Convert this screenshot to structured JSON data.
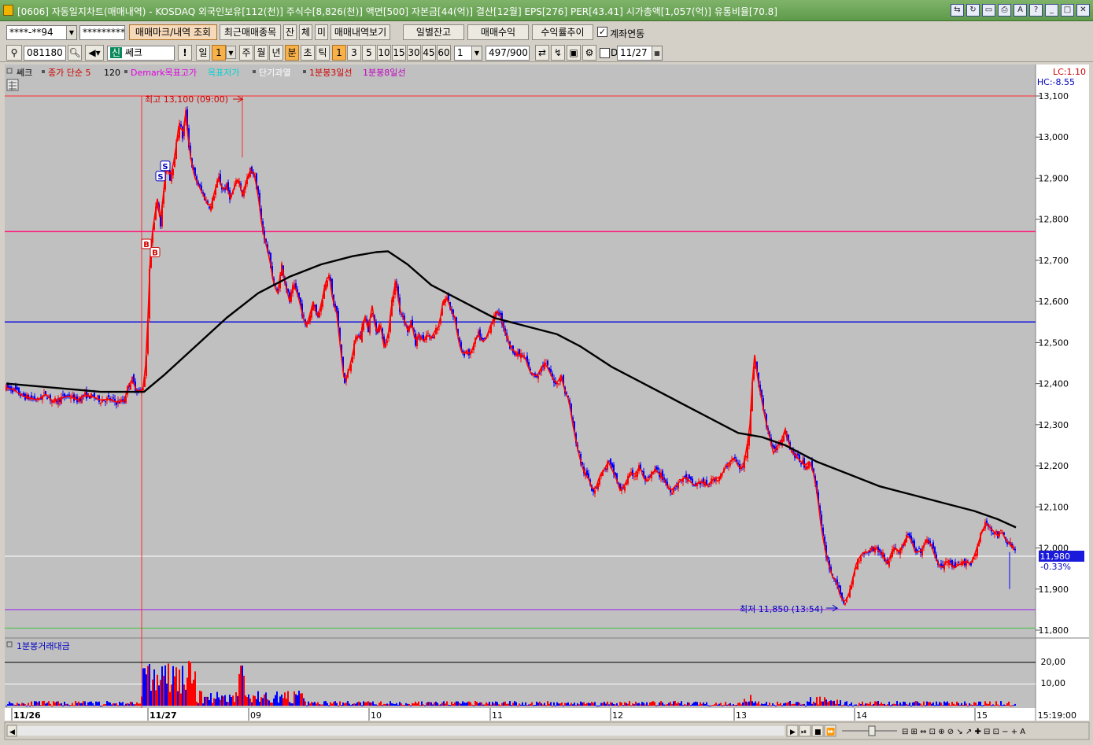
{
  "window": {
    "title": "[0606] 자동일지차트(매매내역) - KOSDAQ 외국인보유[112(천)] 주식수[8,826(천)] 액면[500] 자본금[44(억)] 결산[12월] EPS[276] PER[43.41] 시가총액[1,057(억)] 유통비율[70.8]"
  },
  "toolbar1": {
    "account": "****-**94",
    "password": "*********",
    "btn_markers": "매매마크/내역 조회",
    "btn_recent": "최근매매종목",
    "btn_jan": "잔",
    "btn_che": "체",
    "btn_mi": "미",
    "btn_history": "매매내역보기",
    "btn_daily_balance": "일별잔고",
    "btn_trade_profit": "매매수익",
    "btn_return_trend": "수익률추이",
    "link_label": "계좌연동",
    "link_checked": true
  },
  "toolbar2": {
    "code": "081180",
    "name": "쎄크",
    "name_prefix": "신",
    "exclaim": "!",
    "periods": [
      "일",
      "1",
      "주",
      "월",
      "년",
      "분",
      "초",
      "틱"
    ],
    "intervals": [
      "1",
      "3",
      "5",
      "10",
      "15",
      "30",
      "45",
      "60"
    ],
    "interval_value": "1",
    "count": "497/900",
    "d_label": "D",
    "date": "11/27"
  },
  "chart_data": {
    "type": "candlestick",
    "legend": [
      "쎄크",
      "종가 단순 5",
      "120",
      "Demark목표고가",
      "목표저가",
      "단기과열",
      "1분봉3일선",
      "1분봉8일선"
    ],
    "lc_label": "LC:1.10",
    "hc_label": "HC:-8.55",
    "ylim": [
      11800,
      13100
    ],
    "yticks": [
      "13,100",
      "13,000",
      "12,900",
      "12,800",
      "12,700",
      "12,600",
      "12,500",
      "12,400",
      "12,300",
      "12,200",
      "12,100",
      "12,000",
      "11,900",
      "11,800"
    ],
    "current_price": "11,980",
    "current_change": "-0.33%",
    "high_annotation": "최고 13,100 (09:00)",
    "low_annotation": "최저 11,850 (13:54)",
    "hlines": [
      {
        "value": 13100,
        "color": "#ff2a2a"
      },
      {
        "value": 12770,
        "color": "#ff1a7a"
      },
      {
        "value": 12550,
        "color": "#1010dd"
      },
      {
        "value": 11980,
        "color": "#ffffff"
      },
      {
        "value": 11850,
        "color": "#a020f0"
      },
      {
        "value": 11805,
        "color": "#40c040"
      }
    ],
    "x_labels": [
      "11/26",
      "11/27",
      "09",
      "10",
      "11",
      "12",
      "13",
      "14",
      "15"
    ],
    "time_label": "15:19:00",
    "price_path": [
      [
        0,
        12390
      ],
      [
        10,
        12385
      ],
      [
        20,
        12370
      ],
      [
        30,
        12365
      ],
      [
        40,
        12360
      ],
      [
        50,
        12375
      ],
      [
        60,
        12355
      ],
      [
        70,
        12365
      ],
      [
        80,
        12370
      ],
      [
        90,
        12360
      ],
      [
        100,
        12372
      ],
      [
        110,
        12368
      ],
      [
        120,
        12360
      ],
      [
        130,
        12362
      ],
      [
        140,
        12355
      ],
      [
        150,
        12358
      ],
      [
        155,
        12395
      ],
      [
        160,
        12410
      ],
      [
        165,
        12385
      ],
      [
        170,
        12380
      ],
      [
        175,
        12395
      ],
      [
        178,
        12470
      ],
      [
        180,
        12560
      ],
      [
        182,
        12680
      ],
      [
        185,
        12760
      ],
      [
        188,
        12800
      ],
      [
        192,
        12850
      ],
      [
        196,
        12790
      ],
      [
        200,
        12870
      ],
      [
        204,
        12940
      ],
      [
        208,
        12900
      ],
      [
        212,
        12930
      ],
      [
        216,
        12980
      ],
      [
        220,
        13040
      ],
      [
        224,
        13000
      ],
      [
        228,
        13060
      ],
      [
        232,
        12980
      ],
      [
        236,
        12930
      ],
      [
        240,
        12900
      ],
      [
        245,
        12880
      ],
      [
        250,
        12860
      ],
      [
        255,
        12840
      ],
      [
        260,
        12830
      ],
      [
        265,
        12870
      ],
      [
        270,
        12900
      ],
      [
        275,
        12870
      ],
      [
        280,
        12880
      ],
      [
        285,
        12850
      ],
      [
        290,
        12880
      ],
      [
        295,
        12900
      ],
      [
        300,
        12860
      ],
      [
        305,
        12890
      ],
      [
        310,
        12920
      ],
      [
        315,
        12910
      ],
      [
        320,
        12860
      ],
      [
        325,
        12780
      ],
      [
        330,
        12740
      ],
      [
        335,
        12700
      ],
      [
        340,
        12640
      ],
      [
        345,
        12620
      ],
      [
        350,
        12690
      ],
      [
        355,
        12640
      ],
      [
        360,
        12600
      ],
      [
        365,
        12640
      ],
      [
        370,
        12620
      ],
      [
        375,
        12580
      ],
      [
        380,
        12540
      ],
      [
        385,
        12560
      ],
      [
        390,
        12600
      ],
      [
        395,
        12560
      ],
      [
        400,
        12590
      ],
      [
        405,
        12640
      ],
      [
        410,
        12670
      ],
      [
        415,
        12600
      ],
      [
        420,
        12570
      ],
      [
        425,
        12480
      ],
      [
        430,
        12400
      ],
      [
        435,
        12430
      ],
      [
        440,
        12470
      ],
      [
        445,
        12520
      ],
      [
        450,
        12510
      ],
      [
        455,
        12570
      ],
      [
        460,
        12530
      ],
      [
        465,
        12590
      ],
      [
        470,
        12520
      ],
      [
        475,
        12550
      ],
      [
        480,
        12490
      ],
      [
        485,
        12510
      ],
      [
        490,
        12600
      ],
      [
        495,
        12650
      ],
      [
        500,
        12580
      ],
      [
        505,
        12560
      ],
      [
        510,
        12530
      ],
      [
        515,
        12550
      ],
      [
        520,
        12500
      ],
      [
        525,
        12520
      ],
      [
        530,
        12500
      ],
      [
        535,
        12520
      ],
      [
        540,
        12510
      ],
      [
        545,
        12530
      ],
      [
        550,
        12540
      ],
      [
        555,
        12600
      ],
      [
        560,
        12610
      ],
      [
        565,
        12580
      ],
      [
        570,
        12560
      ],
      [
        575,
        12500
      ],
      [
        580,
        12470
      ],
      [
        585,
        12480
      ],
      [
        590,
        12470
      ],
      [
        595,
        12500
      ],
      [
        600,
        12520
      ],
      [
        605,
        12500
      ],
      [
        610,
        12510
      ],
      [
        615,
        12540
      ],
      [
        620,
        12560
      ],
      [
        625,
        12580
      ],
      [
        630,
        12550
      ],
      [
        635,
        12520
      ],
      [
        640,
        12490
      ],
      [
        645,
        12480
      ],
      [
        650,
        12470
      ],
      [
        655,
        12470
      ],
      [
        660,
        12460
      ],
      [
        665,
        12430
      ],
      [
        670,
        12420
      ],
      [
        675,
        12420
      ],
      [
        680,
        12440
      ],
      [
        685,
        12450
      ],
      [
        690,
        12430
      ],
      [
        695,
        12410
      ],
      [
        700,
        12400
      ],
      [
        705,
        12420
      ],
      [
        710,
        12380
      ],
      [
        715,
        12360
      ],
      [
        720,
        12300
      ],
      [
        725,
        12250
      ],
      [
        730,
        12210
      ],
      [
        735,
        12180
      ],
      [
        740,
        12170
      ],
      [
        745,
        12140
      ],
      [
        750,
        12150
      ],
      [
        755,
        12180
      ],
      [
        760,
        12190
      ],
      [
        765,
        12210
      ],
      [
        770,
        12190
      ],
      [
        775,
        12170
      ],
      [
        780,
        12140
      ],
      [
        785,
        12150
      ],
      [
        790,
        12170
      ],
      [
        795,
        12180
      ],
      [
        800,
        12180
      ],
      [
        805,
        12200
      ],
      [
        810,
        12170
      ],
      [
        815,
        12160
      ],
      [
        820,
        12180
      ],
      [
        825,
        12190
      ],
      [
        830,
        12180
      ],
      [
        835,
        12170
      ],
      [
        840,
        12150
      ],
      [
        845,
        12140
      ],
      [
        850,
        12150
      ],
      [
        855,
        12160
      ],
      [
        860,
        12170
      ],
      [
        865,
        12170
      ],
      [
        870,
        12160
      ],
      [
        875,
        12150
      ],
      [
        880,
        12160
      ],
      [
        885,
        12160
      ],
      [
        890,
        12150
      ],
      [
        895,
        12160
      ],
      [
        900,
        12170
      ],
      [
        905,
        12170
      ],
      [
        910,
        12180
      ],
      [
        915,
        12200
      ],
      [
        920,
        12210
      ],
      [
        925,
        12220
      ],
      [
        930,
        12200
      ],
      [
        935,
        12190
      ],
      [
        940,
        12230
      ],
      [
        945,
        12300
      ],
      [
        948,
        12400
      ],
      [
        951,
        12470
      ],
      [
        955,
        12410
      ],
      [
        960,
        12360
      ],
      [
        965,
        12310
      ],
      [
        970,
        12270
      ],
      [
        975,
        12230
      ],
      [
        980,
        12250
      ],
      [
        985,
        12260
      ],
      [
        990,
        12290
      ],
      [
        995,
        12250
      ],
      [
        1000,
        12230
      ],
      [
        1005,
        12220
      ],
      [
        1010,
        12210
      ],
      [
        1015,
        12200
      ],
      [
        1020,
        12210
      ],
      [
        1025,
        12190
      ],
      [
        1030,
        12140
      ],
      [
        1035,
        12060
      ],
      [
        1040,
        12000
      ],
      [
        1045,
        11960
      ],
      [
        1050,
        11930
      ],
      [
        1055,
        11920
      ],
      [
        1060,
        11880
      ],
      [
        1065,
        11870
      ],
      [
        1070,
        11880
      ],
      [
        1075,
        11920
      ],
      [
        1080,
        11960
      ],
      [
        1085,
        11980
      ],
      [
        1090,
        11990
      ],
      [
        1095,
        11990
      ],
      [
        1100,
        12000
      ],
      [
        1105,
        12000
      ],
      [
        1110,
        11990
      ],
      [
        1115,
        11980
      ],
      [
        1120,
        11960
      ],
      [
        1125,
        11990
      ],
      [
        1130,
        12000
      ],
      [
        1135,
        11990
      ],
      [
        1140,
        12010
      ],
      [
        1145,
        12030
      ],
      [
        1150,
        12020
      ],
      [
        1155,
        11990
      ],
      [
        1160,
        11990
      ],
      [
        1165,
        12000
      ],
      [
        1170,
        12020
      ],
      [
        1175,
        12010
      ],
      [
        1180,
        11980
      ],
      [
        1185,
        11960
      ],
      [
        1190,
        11950
      ],
      [
        1195,
        11970
      ],
      [
        1200,
        11960
      ],
      [
        1205,
        11950
      ],
      [
        1210,
        11960
      ],
      [
        1215,
        11960
      ],
      [
        1220,
        11970
      ],
      [
        1225,
        11960
      ],
      [
        1230,
        11980
      ],
      [
        1235,
        12010
      ],
      [
        1240,
        12040
      ],
      [
        1245,
        12060
      ],
      [
        1250,
        12050
      ],
      [
        1255,
        12040
      ],
      [
        1260,
        12030
      ],
      [
        1265,
        12040
      ],
      [
        1270,
        12020
      ],
      [
        1275,
        12010
      ],
      [
        1280,
        12000
      ],
      [
        1283,
        11990
      ]
    ],
    "ma120_path": [
      [
        0,
        12400
      ],
      [
        60,
        12390
      ],
      [
        120,
        12380
      ],
      [
        175,
        12380
      ],
      [
        200,
        12420
      ],
      [
        240,
        12490
      ],
      [
        280,
        12560
      ],
      [
        320,
        12620
      ],
      [
        360,
        12660
      ],
      [
        400,
        12690
      ],
      [
        440,
        12710
      ],
      [
        470,
        12720
      ],
      [
        485,
        12722
      ],
      [
        510,
        12690
      ],
      [
        540,
        12640
      ],
      [
        580,
        12600
      ],
      [
        620,
        12560
      ],
      [
        660,
        12540
      ],
      [
        700,
        12520
      ],
      [
        730,
        12490
      ],
      [
        770,
        12440
      ],
      [
        810,
        12400
      ],
      [
        850,
        12360
      ],
      [
        890,
        12320
      ],
      [
        930,
        12280
      ],
      [
        960,
        12270
      ],
      [
        990,
        12250
      ],
      [
        1030,
        12210
      ],
      [
        1070,
        12180
      ],
      [
        1110,
        12150
      ],
      [
        1150,
        12130
      ],
      [
        1190,
        12110
      ],
      [
        1230,
        12090
      ],
      [
        1260,
        12070
      ],
      [
        1283,
        12050
      ]
    ],
    "volume": {
      "label": "1분봉거래대금",
      "yticks": [
        "20,00",
        "10,00"
      ],
      "ymax": 28
    },
    "markers": [
      {
        "type": "B",
        "x": 186,
        "value": 12740
      },
      {
        "type": "B",
        "x": 197,
        "value": 12720
      },
      {
        "type": "S",
        "x": 204,
        "value": 12905
      },
      {
        "type": "S",
        "x": 210,
        "value": 12930
      }
    ]
  },
  "colors": {
    "chart_bg": "#c0c0c0",
    "up": "#ff0000",
    "down": "#0000ff",
    "ma5": "#ff0000",
    "ma120": "#000000",
    "axis_bg": "#ffffff"
  }
}
